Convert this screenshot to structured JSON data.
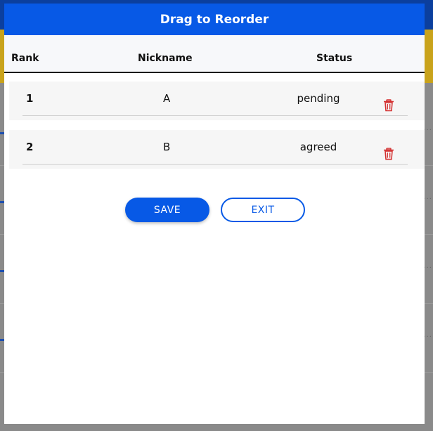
{
  "modal": {
    "title": "Drag to Reorder",
    "columns": {
      "rank": "Rank",
      "nickname": "Nickname",
      "status": "Status"
    },
    "rows": [
      {
        "rank": "1",
        "nickname": "A",
        "status": "pending"
      },
      {
        "rank": "2",
        "nickname": "B",
        "status": "agreed"
      }
    ],
    "buttons": {
      "save": "SAVE",
      "exit": "EXIT"
    }
  },
  "colors": {
    "accent": "#0759e6",
    "delete": "#d32f2f"
  },
  "icons": {
    "delete": "trash-icon"
  }
}
